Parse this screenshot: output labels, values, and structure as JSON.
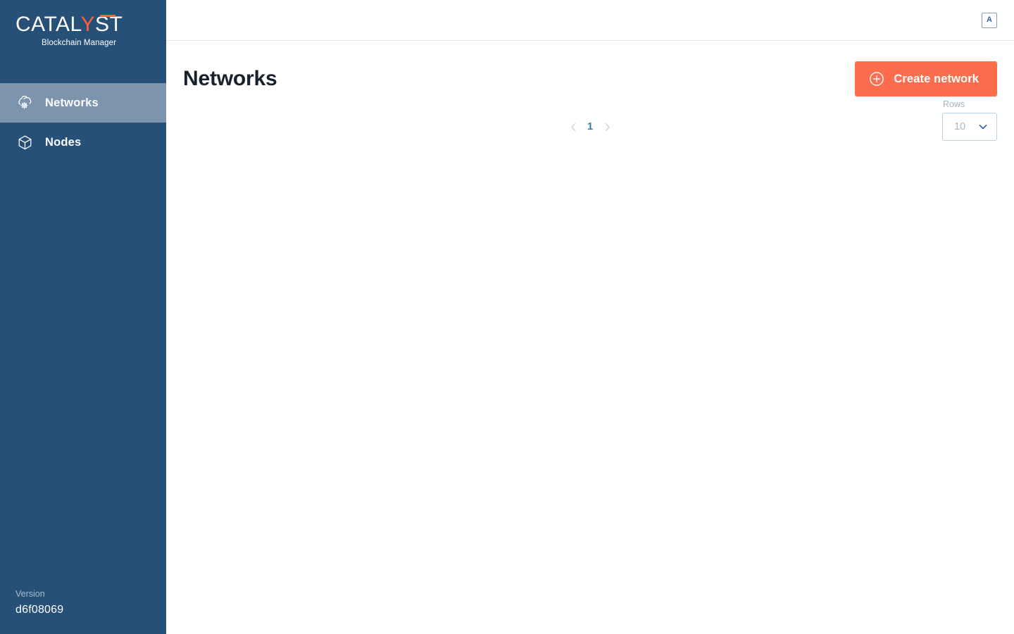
{
  "brand": {
    "wordmark_before": "CATAL",
    "wordmark_accent": "Y",
    "wordmark_after": "ST",
    "subtitle": "Blockchain Manager",
    "accent_color": "#f4633a"
  },
  "sidebar": {
    "background_color": "#265077",
    "active_item_color": "#7c94ae",
    "items": [
      {
        "label": "Networks",
        "icon": "cloud-cog-icon",
        "active": true
      },
      {
        "label": "Nodes",
        "icon": "cube-icon",
        "active": false
      }
    ],
    "version": {
      "label": "Version",
      "value": "d6f08069"
    }
  },
  "topbar": {
    "avatar_initial": "A"
  },
  "page": {
    "title": "Networks",
    "create_button": {
      "label": "Create network",
      "icon": "plus-circle-icon",
      "color": "#fb6d4c"
    }
  },
  "table": {
    "rows": [],
    "empty": true
  },
  "pagination": {
    "prev_icon": "chevron-left-icon",
    "next_icon": "chevron-right-icon",
    "current_page": "1",
    "page_color": "#3a7cb0"
  },
  "rows_selector": {
    "label": "Rows",
    "value": "10",
    "icon": "chevron-down-icon"
  }
}
